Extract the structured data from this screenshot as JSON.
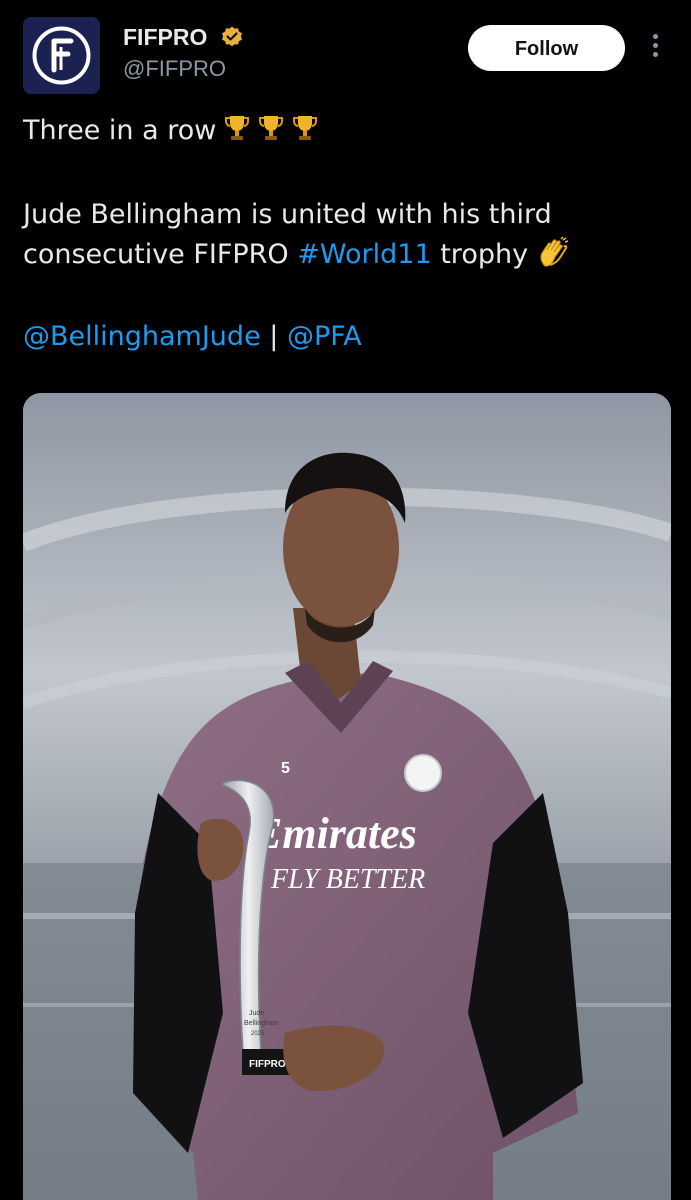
{
  "post": {
    "author": {
      "display_name": "FIFPRO",
      "handle": "@FIFPRO",
      "verified_badge_color": "#e9b13b",
      "avatar_bg": "#1b2150"
    },
    "follow_label": "Follow",
    "text": {
      "line1": "Three in a row",
      "line1_emoji": [
        "trophy-icon",
        "trophy-icon",
        "trophy-icon"
      ],
      "line2": "Jude Bellingham is united with his third",
      "line3_prefix": "consecutive FIFPRO ",
      "hashtag": "#World11",
      "line3_suffix": " trophy",
      "line3_emoji": "clapping-hands-icon",
      "mention1": "@BellinghamJude",
      "separator": " | ",
      "mention2": "@PFA"
    },
    "media": {
      "shirt_number": "5",
      "sponsor_line1": "Emirates",
      "sponsor_line2": "FLY BETTER",
      "trophy_name_line1": "Jude",
      "trophy_name_line2": "Bellingham",
      "trophy_year": "2025",
      "trophy_base_label": "FIFPRO"
    }
  },
  "colors": {
    "background": "#000000",
    "text": "#e7e9ea",
    "secondary_text": "#8b98a5",
    "link": "#1d9bf0"
  }
}
